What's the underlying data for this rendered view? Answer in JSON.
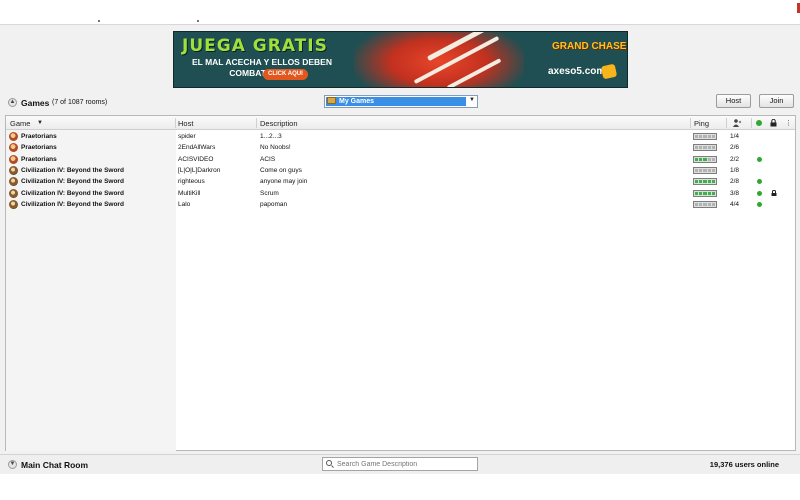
{
  "banner": {
    "headline": "JUEGA GRATIS",
    "subline": "EL MAL ACECHA Y ELLOS DEBEN COMBATIRLO!!!",
    "cta": "CLICK AQUI",
    "brand": "GRAND CHASE",
    "site": "axeso5.com"
  },
  "games": {
    "title": "Games",
    "count": "(7 of 1087 rooms)",
    "filter": "My Games",
    "host_button": "Host",
    "join_button": "Join",
    "columns": {
      "game": "Game",
      "host": "Host",
      "description": "Description",
      "ping": "Ping"
    },
    "rows": [
      {
        "game": "Praetorians",
        "host": "spider",
        "description": "1...2...3",
        "players": "1/4",
        "ping_level": 0,
        "open": false,
        "locked": false,
        "icon": "praetorians-icon"
      },
      {
        "game": "Praetorians",
        "host": "2EndAllWars",
        "description": "No Noobs!",
        "players": "2/6",
        "ping_level": 0,
        "open": false,
        "locked": false,
        "icon": "praetorians-icon"
      },
      {
        "game": "Praetorians",
        "host": "ACISVIDEO",
        "description": "ACIS",
        "players": "2/2",
        "ping_level": 3,
        "open": true,
        "locked": false,
        "icon": "praetorians-icon"
      },
      {
        "game": "Civilization IV: Beyond the Sword",
        "host": "[L|O|L]Darkron",
        "description": "Come on guys",
        "players": "1/8",
        "ping_level": 0,
        "open": false,
        "locked": false,
        "icon": "civ4-icon"
      },
      {
        "game": "Civilization IV: Beyond the Sword",
        "host": "righteous",
        "description": "anyone may join",
        "players": "2/8",
        "ping_level": 5,
        "open": true,
        "locked": false,
        "icon": "civ4-icon"
      },
      {
        "game": "Civilization IV: Beyond the Sword",
        "host": "MultiKill",
        "description": "Scrum",
        "players": "3/8",
        "ping_level": 5,
        "open": true,
        "locked": true,
        "icon": "civ4-icon"
      },
      {
        "game": "Civilization IV: Beyond the Sword",
        "host": "Lalo",
        "description": "papoman",
        "players": "4/4",
        "ping_level": 0,
        "open": true,
        "locked": false,
        "icon": "civ4-icon"
      }
    ]
  },
  "chat": {
    "title": "Main Chat Room",
    "search_placeholder": "Search Game Description",
    "users_online": "19,376 users online"
  },
  "colors": {
    "selection": "#3a8ee6",
    "ping_good": "#3cb34a",
    "open_dot": "#2fa832"
  }
}
